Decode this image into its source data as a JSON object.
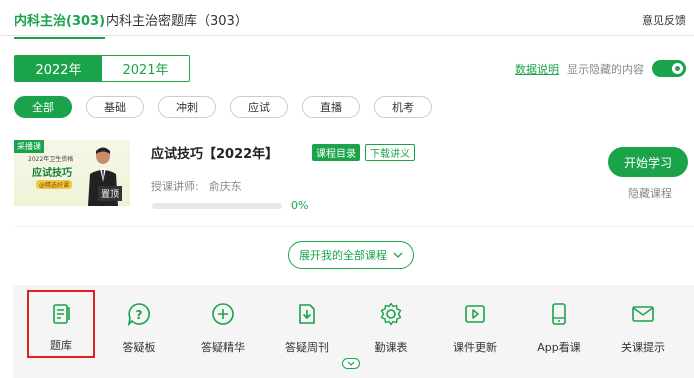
{
  "header": {
    "tabs": [
      {
        "label": "内科主治(303)",
        "active": true
      },
      {
        "label": "内科主治密题库（303）",
        "active": false
      }
    ],
    "feedback": "意见反馈"
  },
  "years": [
    {
      "label": "2022年",
      "active": true
    },
    {
      "label": "2021年",
      "active": false
    }
  ],
  "options": {
    "data_note": "数据说明",
    "show_hidden": "显示隐藏的内容",
    "toggle_on": true
  },
  "filters": [
    {
      "label": "全部",
      "active": true
    },
    {
      "label": "基础",
      "active": false
    },
    {
      "label": "冲刺",
      "active": false
    },
    {
      "label": "应试",
      "active": false
    },
    {
      "label": "直播",
      "active": false
    },
    {
      "label": "机考",
      "active": false
    }
  ],
  "course": {
    "thumb_badge": "采播课",
    "thumb_line1": "2022年卫生资格",
    "thumb_line2": "应试技巧",
    "thumb_line3": "@精选好课",
    "thumb_pin": "置顶",
    "title": "应试技巧【2022年】",
    "tag_catalog": "课程目录",
    "tag_handout": "下载讲义",
    "teacher_label": "授课讲师:",
    "teacher_name": "俞庆东",
    "progress": 0,
    "progress_text": "0%",
    "start_label": "开始学习",
    "hide_label": "隐藏课程"
  },
  "expand_label": "展开我的全部课程",
  "tools": [
    {
      "label": "题库",
      "icon": "question-bank-icon",
      "selected": true
    },
    {
      "label": "答疑板",
      "icon": "qa-board-icon",
      "selected": false
    },
    {
      "label": "答疑精华",
      "icon": "qa-essence-icon",
      "selected": false
    },
    {
      "label": "答疑周刊",
      "icon": "qa-weekly-icon",
      "selected": false
    },
    {
      "label": "勤课表",
      "icon": "schedule-gear-icon",
      "selected": false
    },
    {
      "label": "课件更新",
      "icon": "courseware-update-icon",
      "selected": false
    },
    {
      "label": "App看课",
      "icon": "app-phone-icon",
      "selected": false
    },
    {
      "label": "关课提示",
      "icon": "mail-notice-icon",
      "selected": false
    }
  ],
  "colors": {
    "accent": "#1aa34a",
    "highlight": "#e02020"
  }
}
